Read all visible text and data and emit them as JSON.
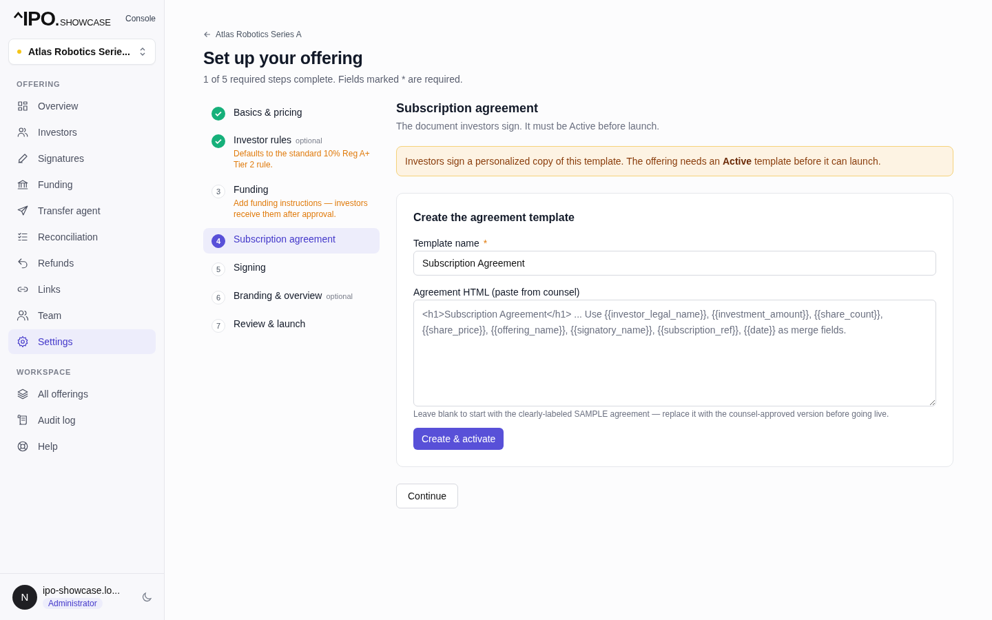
{
  "brand": {
    "logo_main": "IPO",
    "logo_dot": ".",
    "logo_sub": "SHOWCASE",
    "console": "Console"
  },
  "offering_switcher": {
    "label": "Atlas Robotics Serie...",
    "color": "#f5c518"
  },
  "sidebar": {
    "sections": [
      {
        "title": "OFFERING",
        "items": [
          {
            "label": "Overview",
            "selected": false
          },
          {
            "label": "Investors",
            "selected": false
          },
          {
            "label": "Signatures",
            "selected": false
          },
          {
            "label": "Funding",
            "selected": false
          },
          {
            "label": "Transfer agent",
            "selected": false
          },
          {
            "label": "Reconciliation",
            "selected": false
          },
          {
            "label": "Refunds",
            "selected": false
          },
          {
            "label": "Links",
            "selected": false
          },
          {
            "label": "Team",
            "selected": false
          },
          {
            "label": "Settings",
            "selected": true
          }
        ]
      },
      {
        "title": "WORKSPACE",
        "items": [
          {
            "label": "All offerings",
            "selected": false
          },
          {
            "label": "Audit log",
            "selected": false
          },
          {
            "label": "Help",
            "selected": false
          }
        ]
      }
    ]
  },
  "user": {
    "avatar": "N",
    "email": "ipo-showcase.lo...",
    "role": "Administrator"
  },
  "back_link": "Atlas Robotics Series A",
  "title": "Set up your offering",
  "subtitle": "1 of 5 required steps complete. Fields marked * are required.",
  "steps": [
    {
      "label": "Basics & pricing",
      "completed": true,
      "selected": false
    },
    {
      "label": "Investor rules",
      "tag": "optional",
      "note": "Defaults to the standard 10% Reg A+ Tier 2 rule.",
      "completed": true,
      "selected": false
    },
    {
      "number": "3",
      "label": "Funding",
      "note": "Add funding instructions — investors receive them after approval.",
      "completed": false,
      "selected": false
    },
    {
      "number": "4",
      "label": "Subscription agreement",
      "completed": false,
      "selected": true
    },
    {
      "number": "5",
      "label": "Signing",
      "completed": false,
      "selected": false
    },
    {
      "number": "6",
      "label": "Branding & overview",
      "tag": "optional",
      "completed": false,
      "selected": false
    },
    {
      "number": "7",
      "label": "Review & launch",
      "completed": false,
      "selected": false
    }
  ],
  "section": {
    "title": "Subscription agreement",
    "description": "The document investors sign. It must be Active before launch.",
    "notice": "Investors sign a personalized copy of this template. The offering needs an **Active** template before it can launch.",
    "card": {
      "title": "Create the agreement template",
      "template_name": {
        "label": "Template name",
        "required_mark": "*",
        "value": "Subscription Agreement"
      },
      "agreement_html": {
        "label": "Agreement HTML (paste from counsel)",
        "placeholder": "<h1>Subscription Agreement</h1> ... Use {{investor_legal_name}}, {{investment_amount}}, {{share_count}}, {{share_price}}, {{offering_name}}, {{signatory_name}}, {{subscription_ref}}, {{date}} as merge fields.",
        "help": "Leave blank to start with the clearly-labeled SAMPLE agreement — replace it with the counsel-approved version before going live."
      },
      "primary_button": "Create & activate"
    },
    "continue_button": "Continue"
  }
}
